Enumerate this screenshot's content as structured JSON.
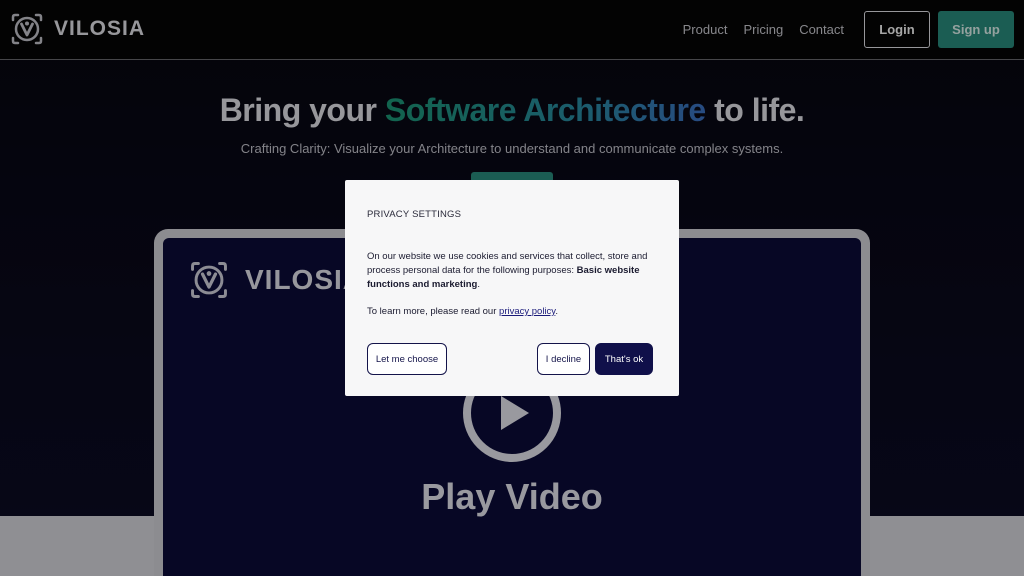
{
  "brand": {
    "name": "VILOSIA"
  },
  "nav": {
    "links": [
      "Product",
      "Pricing",
      "Contact"
    ],
    "login_label": "Login",
    "signup_label": "Sign up"
  },
  "hero": {
    "title_prefix": "Bring your ",
    "title_accent": "Software Architecture",
    "title_suffix": " to life.",
    "subtitle": "Crafting Clarity: Visualize your Architecture to understand and communicate complex systems."
  },
  "video": {
    "brand": "VILOSIA",
    "play_label": "Play Video"
  },
  "cookie_modal": {
    "title": "PRIVACY SETTINGS",
    "body_prefix": "On our website we use cookies and services that collect, store and process personal data for the following purposes: ",
    "body_bold": "Basic website functions and marketing",
    "body_suffix": ".",
    "learn_prefix": "To learn more, please read our ",
    "learn_link": "privacy policy",
    "learn_suffix": ".",
    "choose_label": "Let me choose",
    "decline_label": "I decline",
    "ok_label": "That's ok"
  },
  "colors": {
    "accent_teal": "#2a8f80",
    "modal_primary": "#10104a",
    "video_bg": "#0b0b3a"
  }
}
